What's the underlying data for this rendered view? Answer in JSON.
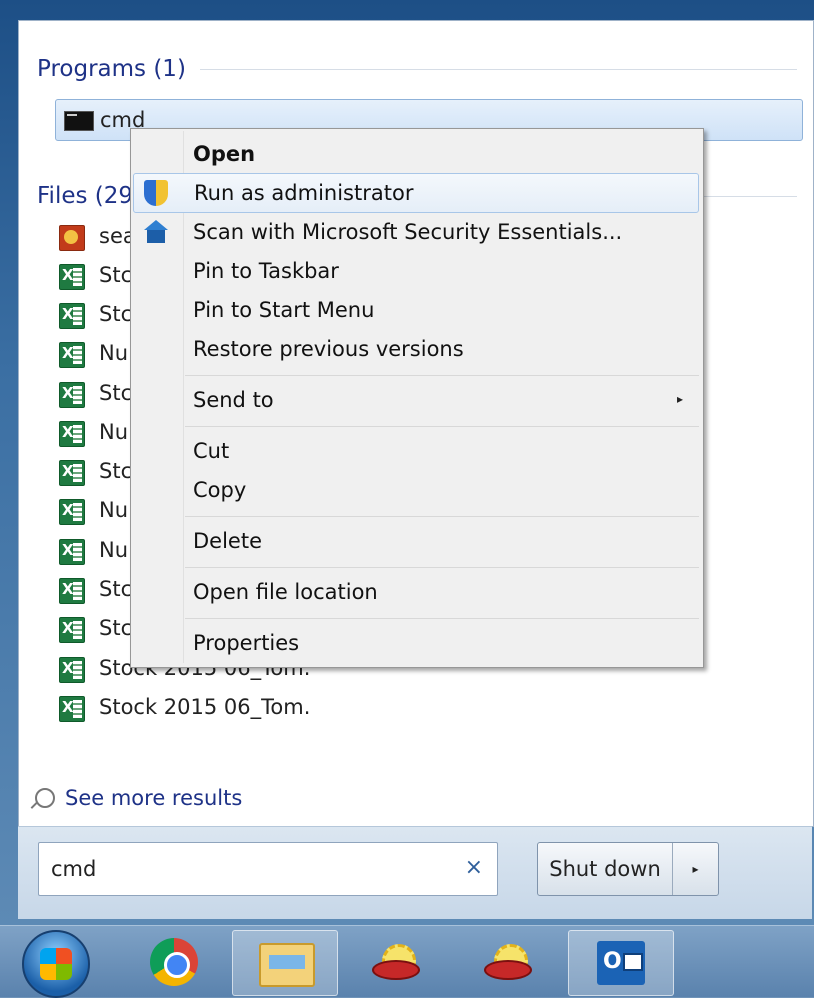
{
  "start_menu": {
    "programs_header": "Programs (1)",
    "program_items": [
      {
        "label": "cmd"
      }
    ],
    "files_header": "Files (29",
    "file_items": [
      {
        "label": "sea",
        "icon": "search-file-icon"
      },
      {
        "label": "Stc",
        "icon": "excel-file-icon"
      },
      {
        "label": "Stc",
        "icon": "excel-file-icon"
      },
      {
        "label": "Nu",
        "icon": "excel-file-icon"
      },
      {
        "label": "Stc",
        "icon": "excel-file-icon"
      },
      {
        "label": "Nu",
        "icon": "excel-file-icon"
      },
      {
        "label": "Stc",
        "icon": "excel-file-icon"
      },
      {
        "label": "Nu",
        "icon": "excel-file-icon"
      },
      {
        "label": "Nu",
        "icon": "excel-file-icon"
      },
      {
        "label": "Stc",
        "icon": "excel-file-icon"
      },
      {
        "label": "Stc",
        "icon": "excel-file-icon"
      },
      {
        "label": "Stock 2015 06_Tom.",
        "icon": "excel-file-icon"
      },
      {
        "label": "Stock 2015 06_Tom.",
        "icon": "excel-file-icon"
      }
    ],
    "see_more": "See more results",
    "search": {
      "value": "cmd",
      "clear_glyph": "×"
    },
    "shutdown": {
      "label": "Shut down",
      "arrow_glyph": "▸"
    }
  },
  "context_menu": {
    "items": [
      {
        "label": "Open",
        "bold": true
      },
      {
        "label": "Run as administrator",
        "icon": "uac-shield-icon",
        "highlighted": true
      },
      {
        "label": "Scan with Microsoft Security Essentials...",
        "icon": "security-essentials-icon"
      },
      {
        "label": "Pin to Taskbar"
      },
      {
        "label": "Pin to Start Menu"
      },
      {
        "label": "Restore previous versions"
      },
      {
        "label": "Send to",
        "submenu_glyph": "▸"
      },
      {
        "label": "Cut"
      },
      {
        "label": "Copy"
      },
      {
        "label": "Delete"
      },
      {
        "label": "Open file location"
      },
      {
        "label": "Properties"
      }
    ]
  },
  "taskbar": {
    "items": [
      {
        "name": "start-orb"
      },
      {
        "name": "chrome-icon"
      },
      {
        "name": "file-explorer-icon",
        "active": true
      },
      {
        "name": "app-icon"
      },
      {
        "name": "app-icon"
      },
      {
        "name": "outlook-icon",
        "active": true
      }
    ]
  }
}
